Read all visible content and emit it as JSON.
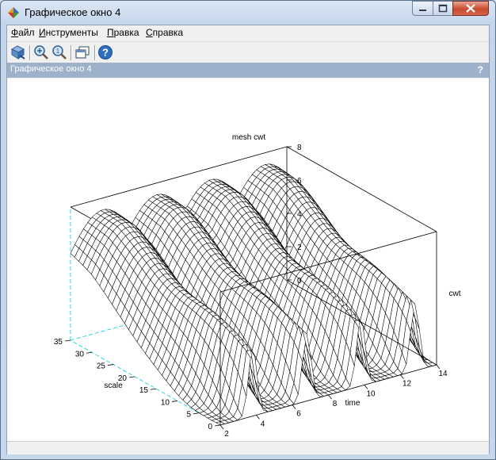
{
  "window": {
    "title": "Графическое окно 4"
  },
  "menubar": {
    "items": [
      "Файл",
      "Инструменты",
      "Правка",
      "Справка"
    ]
  },
  "toolbar": {
    "tools": [
      "rotate-icon",
      "zoom-in-icon",
      "zoom-fit-icon",
      "window-icon",
      "help-icon"
    ]
  },
  "panel": {
    "title": "Графическое окно 4",
    "help": "?"
  },
  "chart_data": {
    "type": "surface-mesh",
    "title": "mesh cwt",
    "xlabel": "time",
    "ylabel": "scale",
    "zlabel": "cwt",
    "xlim": [
      2,
      14
    ],
    "ylim": [
      0,
      35
    ],
    "zlim": [
      0,
      8
    ],
    "x_ticks": [
      "2",
      "4",
      "6",
      "8",
      "10",
      "12",
      "14"
    ],
    "y_ticks": [
      "0",
      "5",
      "10",
      "15",
      "20",
      "25",
      "30",
      "35"
    ],
    "z_ticks": [
      "0",
      "2",
      "4",
      "6",
      "8"
    ],
    "ridges_time": [
      3.8,
      6.8,
      9.8,
      12.8
    ]
  }
}
